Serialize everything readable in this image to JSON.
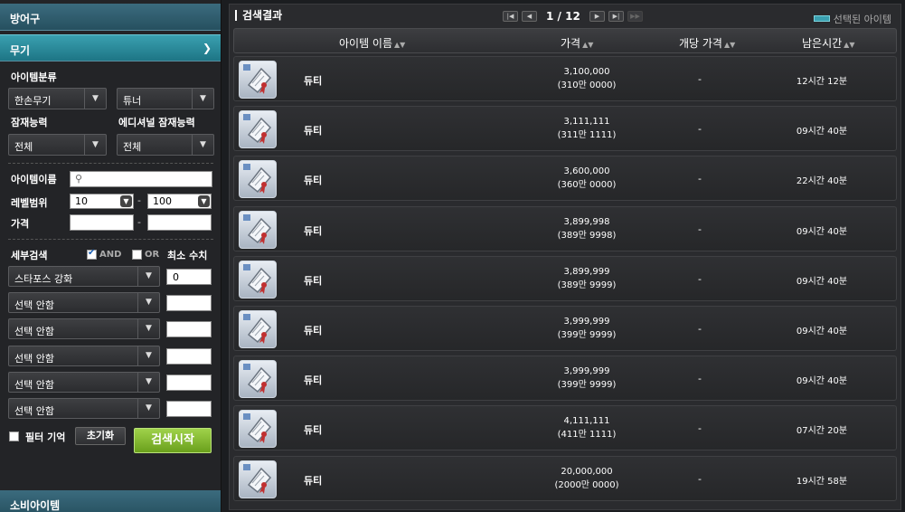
{
  "left": {
    "cat_armor": "방어구",
    "cat_weapon": "무기",
    "cat_consumable": "소비아이템",
    "item_category_label": "아이템분류",
    "item_category_value": "한손무기",
    "item_subcategory_value": "튜너",
    "potential_label": "잠재능력",
    "potential_value": "전체",
    "additional_potential_label": "에디셔널 잠재능력",
    "additional_potential_value": "전체",
    "item_name_label": "아이템이름",
    "item_name_value": "",
    "level_label": "레벨범위",
    "level_min": "10",
    "level_max": "100",
    "price_label": "가격",
    "price_min": "",
    "price_max": "",
    "range_sep": "-",
    "detail_search_label": "세부검색",
    "and_label": "AND",
    "and_checked": true,
    "or_label": "OR",
    "or_checked": false,
    "min_value_label": "최소 수치",
    "detail_filters": [
      {
        "option": "스타포스 강화",
        "value": "0"
      },
      {
        "option": "선택 안함",
        "value": ""
      },
      {
        "option": "선택 안함",
        "value": ""
      },
      {
        "option": "선택 안함",
        "value": ""
      },
      {
        "option": "선택 안함",
        "value": ""
      },
      {
        "option": "선택 안함",
        "value": ""
      }
    ],
    "filter_memory_label": "필터 기억",
    "reset_label": "초기화",
    "search_button_label": "검색시작"
  },
  "results": {
    "title": "검색결과",
    "page_current": "1",
    "page_total": "12",
    "page_sep": "/",
    "legend": "선택된 아이템",
    "col_name": "아이템 이름",
    "col_price": "가격",
    "col_unit_price": "개당 가격",
    "col_time_left": "남은시간",
    "rows": [
      {
        "name": "듀티",
        "price": "3,100,000",
        "price_kr": "(310만 0000)",
        "unit": "-",
        "time": "12시간 12분"
      },
      {
        "name": "듀티",
        "price": "3,111,111",
        "price_kr": "(311만 1111)",
        "unit": "-",
        "time": "09시간 40분"
      },
      {
        "name": "듀티",
        "price": "3,600,000",
        "price_kr": "(360만 0000)",
        "unit": "-",
        "time": "22시간 40분"
      },
      {
        "name": "듀티",
        "price": "3,899,998",
        "price_kr": "(389만 9998)",
        "unit": "-",
        "time": "09시간 40분"
      },
      {
        "name": "듀티",
        "price": "3,899,999",
        "price_kr": "(389만 9999)",
        "unit": "-",
        "time": "09시간 40분"
      },
      {
        "name": "듀티",
        "price": "3,999,999",
        "price_kr": "(399만 9999)",
        "unit": "-",
        "time": "09시간 40분"
      },
      {
        "name": "듀티",
        "price": "3,999,999",
        "price_kr": "(399만 9999)",
        "unit": "-",
        "time": "09시간 40분"
      },
      {
        "name": "듀티",
        "price": "4,111,111",
        "price_kr": "(411만 1111)",
        "unit": "-",
        "time": "07시간 20분"
      },
      {
        "name": "듀티",
        "price": "20,000,000",
        "price_kr": "(2000만 0000)",
        "unit": "-",
        "time": "19시간 58분"
      }
    ]
  },
  "icons": {
    "item_icon": "scroll-icon",
    "accent": "#3aa0b0",
    "search_green": "#8cc63f"
  }
}
